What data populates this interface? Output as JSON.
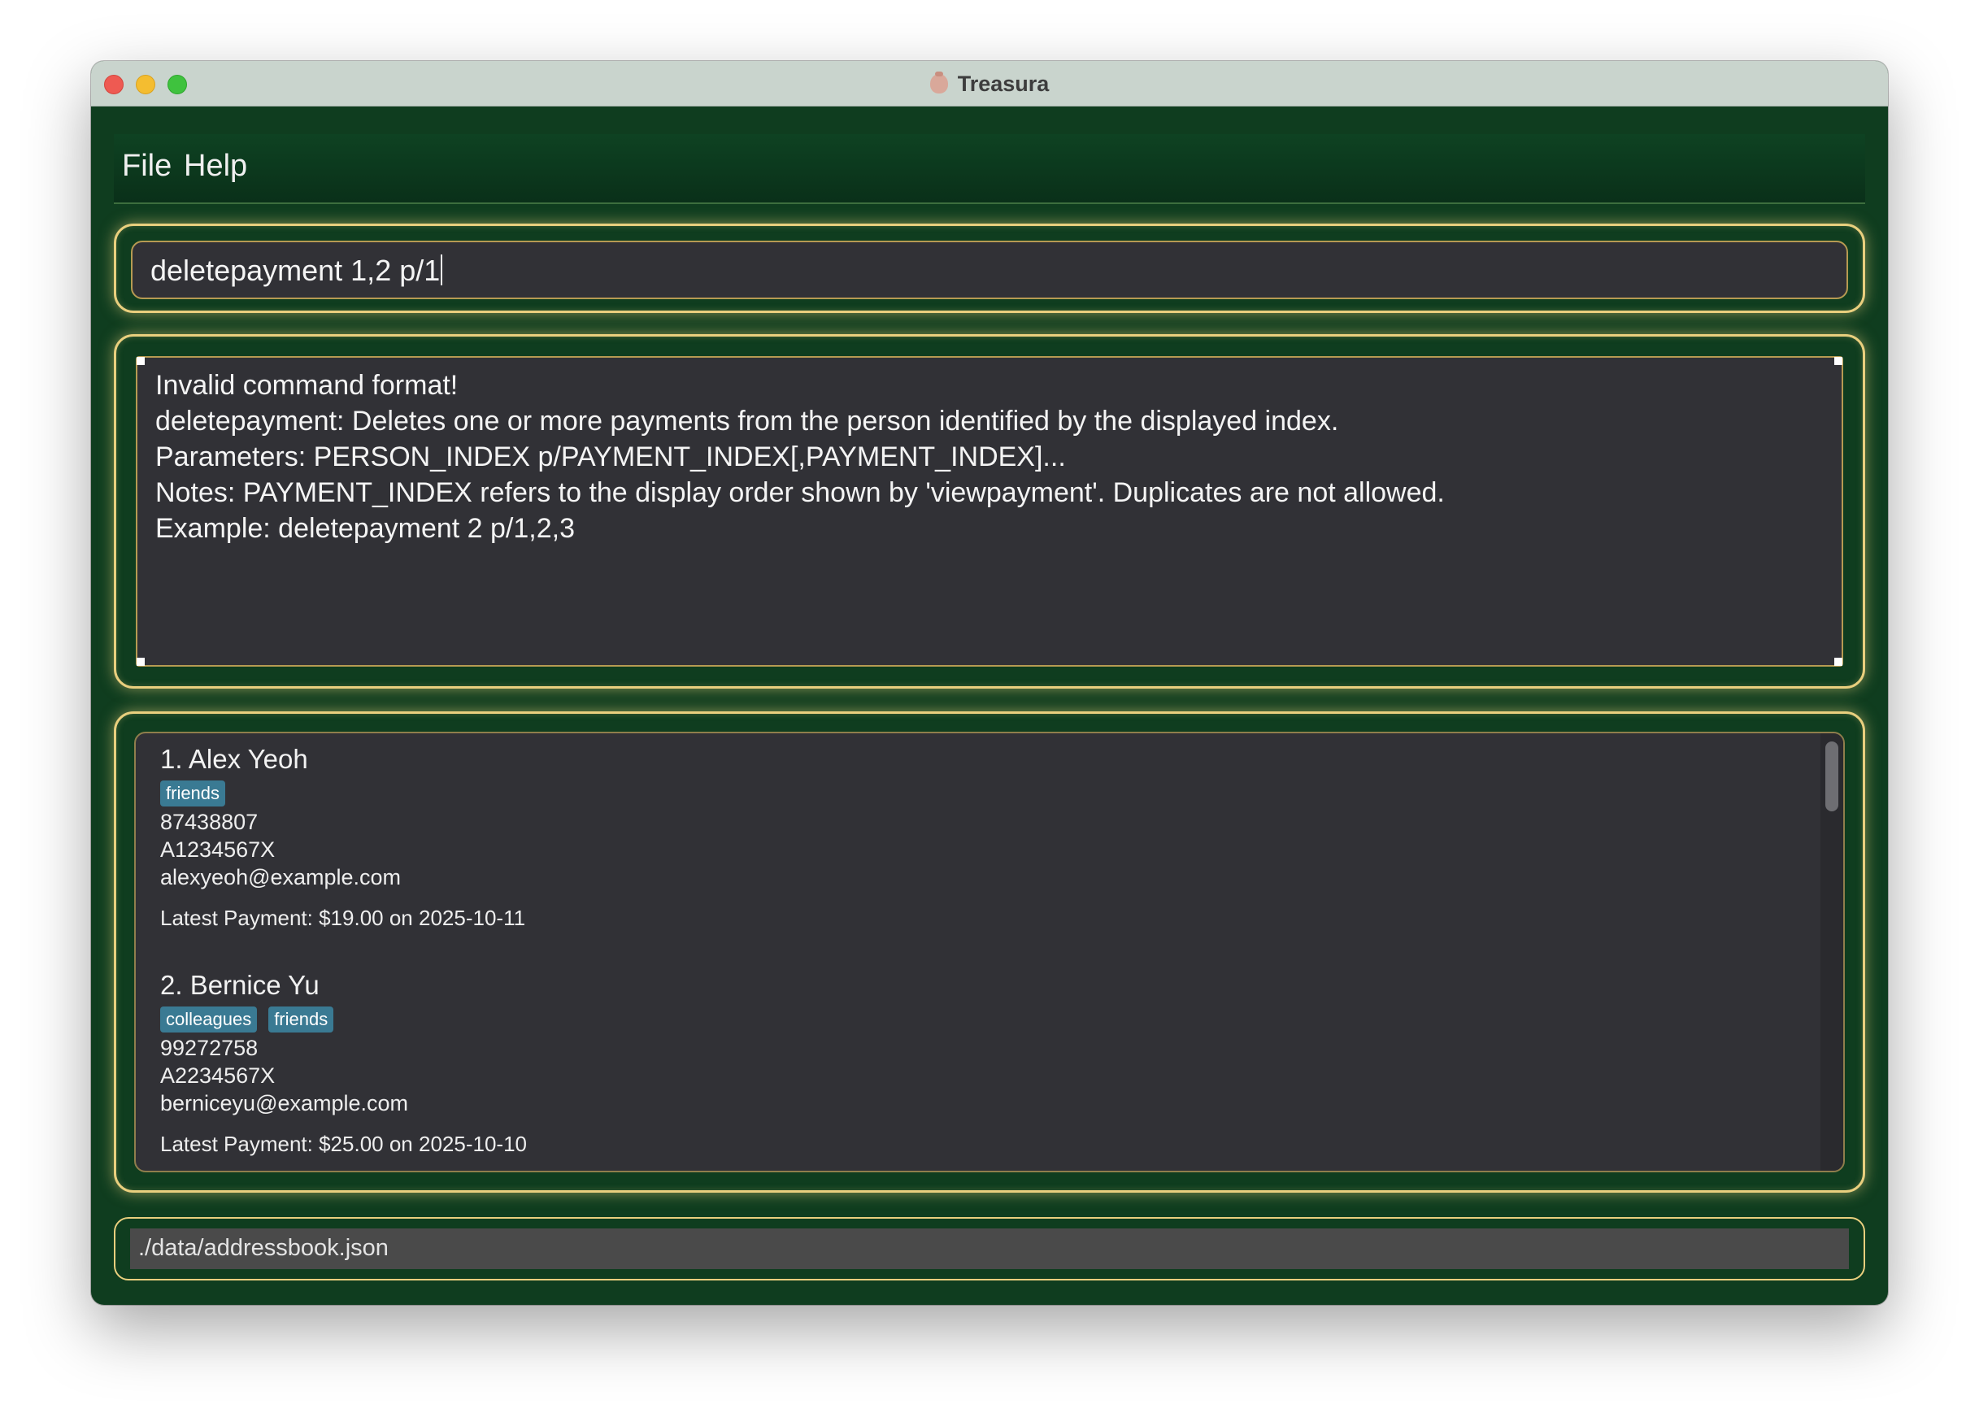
{
  "window": {
    "title": "Treasura"
  },
  "menu": {
    "file": "File",
    "help": "Help"
  },
  "command": {
    "value": "deletepayment 1,2 p/1"
  },
  "result": {
    "lines": [
      "Invalid command format!",
      "deletepayment: Deletes one or more payments from the person identified by the displayed index.",
      "Parameters: PERSON_INDEX p/PAYMENT_INDEX[,PAYMENT_INDEX]...",
      "Notes: PAYMENT_INDEX refers to the display order shown by 'viewpayment'. Duplicates are not allowed.",
      "Example: deletepayment 2 p/1,2,3"
    ]
  },
  "persons": [
    {
      "name": "1. Alex Yeoh",
      "tags": [
        "friends"
      ],
      "phone": "87438807",
      "id": "A1234567X",
      "email": "alexyeoh@example.com",
      "payment": "Latest Payment: $19.00 on 2025-10-11"
    },
    {
      "name": "2. Bernice Yu",
      "tags": [
        "colleagues",
        "friends"
      ],
      "phone": "99272758",
      "id": "A2234567X",
      "email": "berniceyu@example.com",
      "payment": "Latest Payment: $25.00 on 2025-10-10"
    }
  ],
  "status": {
    "path": "./data/addressbook.json"
  },
  "colors": {
    "background": "#0f3d1f",
    "panel_border": "#e9cf7e",
    "box": "#313136",
    "tag": "#3a7a93"
  }
}
